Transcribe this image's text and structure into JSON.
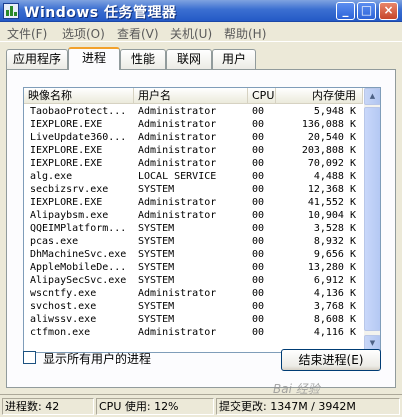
{
  "window": {
    "title": "Windows 任务管理器",
    "buttons": {
      "minimize": "_",
      "maximize": "□",
      "close": "×"
    }
  },
  "menu": [
    "文件(F)",
    "选项(O)",
    "查看(V)",
    "关机(U)",
    "帮助(H)"
  ],
  "tabs": [
    "应用程序",
    "进程",
    "性能",
    "联网",
    "用户"
  ],
  "active_tab": "进程",
  "columns": {
    "name": "映像名称",
    "user": "用户名",
    "cpu": "CPU",
    "mem": "内存使用"
  },
  "processes": [
    {
      "name": "TaobaoProtect...",
      "user": "Administrator",
      "cpu": "00",
      "mem": "5,948 K"
    },
    {
      "name": "IEXPLORE.EXE",
      "user": "Administrator",
      "cpu": "00",
      "mem": "136,088 K"
    },
    {
      "name": "LiveUpdate360...",
      "user": "Administrator",
      "cpu": "00",
      "mem": "20,540 K"
    },
    {
      "name": "IEXPLORE.EXE",
      "user": "Administrator",
      "cpu": "00",
      "mem": "203,808 K"
    },
    {
      "name": "IEXPLORE.EXE",
      "user": "Administrator",
      "cpu": "00",
      "mem": "70,092 K"
    },
    {
      "name": "alg.exe",
      "user": "LOCAL SERVICE",
      "cpu": "00",
      "mem": "4,488 K"
    },
    {
      "name": "secbizsrv.exe",
      "user": "SYSTEM",
      "cpu": "00",
      "mem": "12,368 K"
    },
    {
      "name": "IEXPLORE.EXE",
      "user": "Administrator",
      "cpu": "00",
      "mem": "41,552 K"
    },
    {
      "name": "Alipaybsm.exe",
      "user": "Administrator",
      "cpu": "00",
      "mem": "10,904 K"
    },
    {
      "name": "QQEIMPlatform...",
      "user": "SYSTEM",
      "cpu": "00",
      "mem": "3,528 K"
    },
    {
      "name": "pcas.exe",
      "user": "SYSTEM",
      "cpu": "00",
      "mem": "8,932 K"
    },
    {
      "name": "DhMachineSvc.exe",
      "user": "SYSTEM",
      "cpu": "00",
      "mem": "9,656 K"
    },
    {
      "name": "AppleMobileDe...",
      "user": "SYSTEM",
      "cpu": "00",
      "mem": "13,280 K"
    },
    {
      "name": "AlipaySecSvc.exe",
      "user": "SYSTEM",
      "cpu": "00",
      "mem": "6,912 K"
    },
    {
      "name": "wscntfy.exe",
      "user": "Administrator",
      "cpu": "00",
      "mem": "4,136 K"
    },
    {
      "name": "svchost.exe",
      "user": "SYSTEM",
      "cpu": "00",
      "mem": "3,768 K"
    },
    {
      "name": "aliwssv.exe",
      "user": "SYSTEM",
      "cpu": "00",
      "mem": "8,608 K"
    },
    {
      "name": "ctfmon.exe",
      "user": "Administrator",
      "cpu": "00",
      "mem": "4,116 K"
    }
  ],
  "show_all_users_label": "显示所有用户的进程",
  "end_process_button": "结束进程(E)",
  "status": {
    "processes": "进程数: 42",
    "cpu": "CPU 使用: 12%",
    "commit": "提交更改: 1347M / 3942M"
  },
  "watermark": "Bai 经验",
  "colors": {
    "titlebar": "#2459c6",
    "active_tab_accent": "#f2a12d",
    "window_bg": "#ece9d8"
  }
}
